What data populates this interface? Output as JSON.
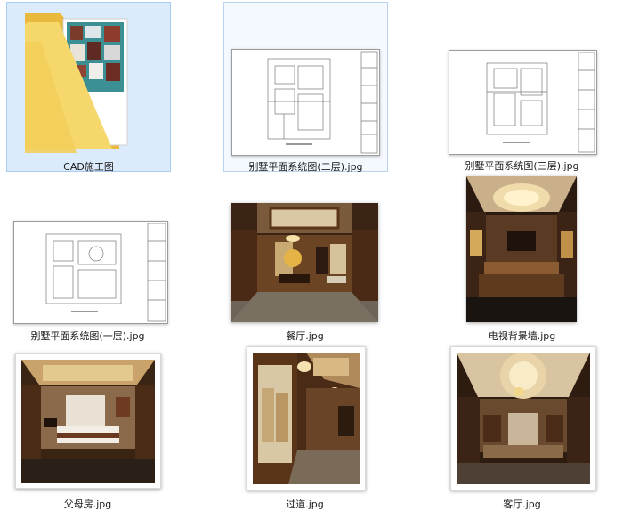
{
  "items": [
    {
      "label": "CAD施工图",
      "icon": "folder-icon",
      "kind": "folder"
    },
    {
      "label": "别墅平面系统图(二层).jpg",
      "icon": "floorplan-icon",
      "kind": "plan"
    },
    {
      "label": "别墅平面系统图(三层).jpg",
      "icon": "floorplan-icon",
      "kind": "plan"
    },
    {
      "label": "别墅平面系统图(一层).jpg",
      "icon": "floorplan-icon",
      "kind": "plan"
    },
    {
      "label": "餐厅.jpg",
      "icon": "dining-room-photo",
      "kind": "photo"
    },
    {
      "label": "电视背景墙.jpg",
      "icon": "tv-wall-photo",
      "kind": "photo"
    },
    {
      "label": "父母房.jpg",
      "icon": "bedroom-photo",
      "kind": "photo"
    },
    {
      "label": "过道.jpg",
      "icon": "corridor-photo",
      "kind": "photo"
    },
    {
      "label": "客厅.jpg",
      "icon": "living-room-photo",
      "kind": "photo"
    }
  ],
  "colors": {
    "selection_bg": "#dcebfb",
    "selection_border": "#a9cdf3",
    "folder": "#f3cf5a",
    "wood": "#5a3418"
  }
}
